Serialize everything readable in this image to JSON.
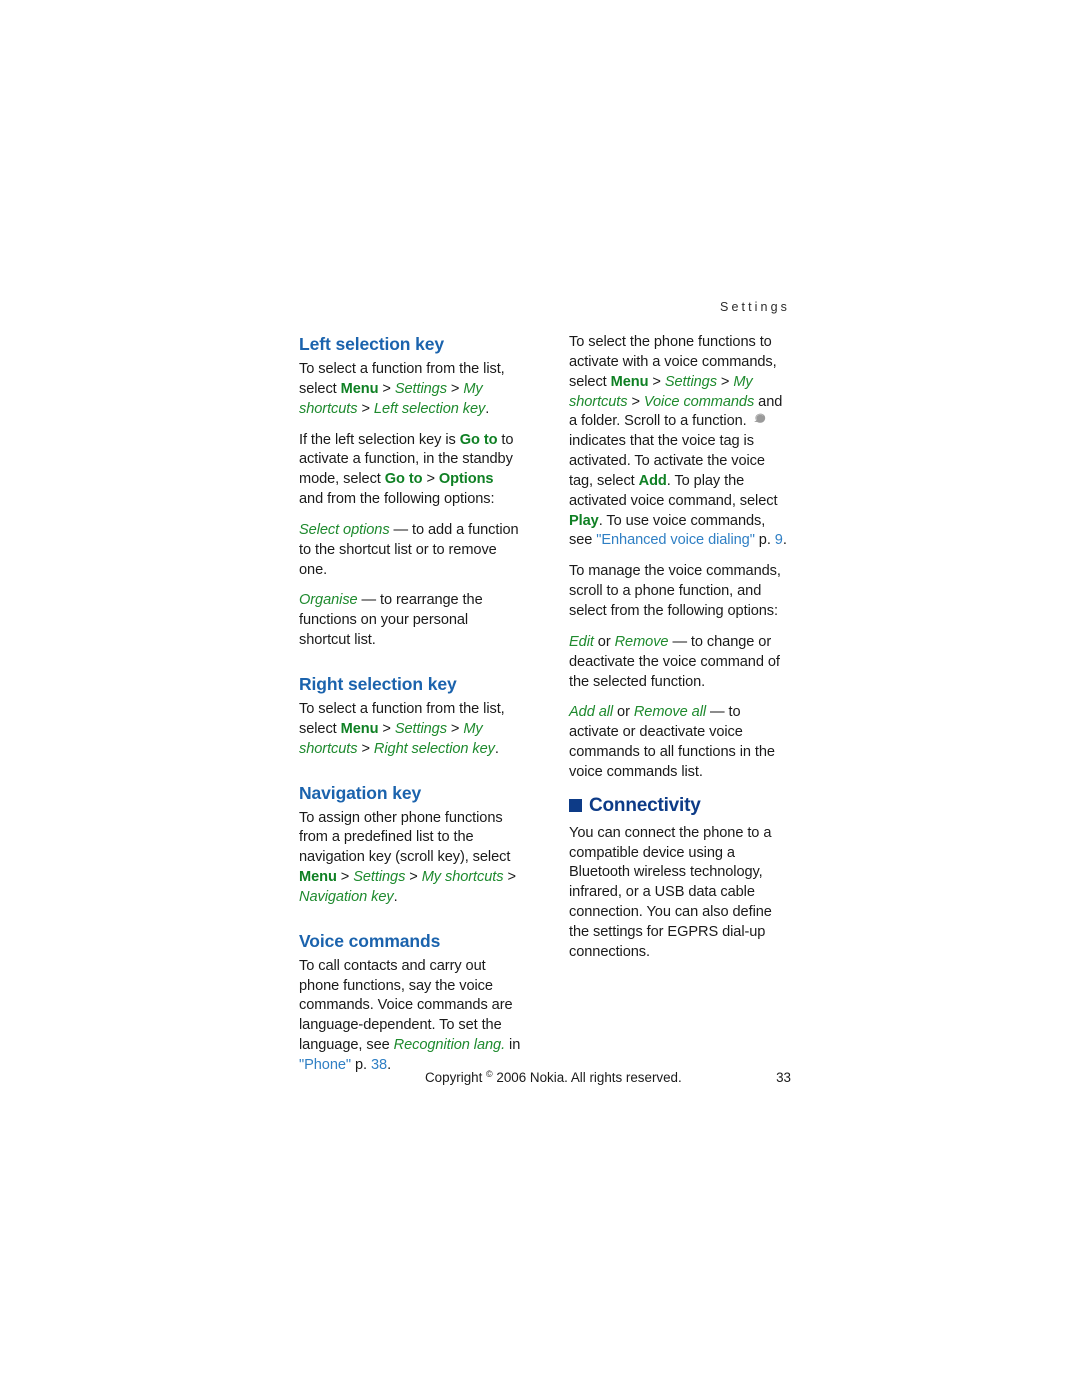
{
  "running_head": "Settings",
  "colors": {
    "section_heading": "#1b63ad",
    "chapter_heading": "#0d3b87",
    "menu_path_green": "#1e8a2e",
    "bold_term_green": "#0f8024",
    "cross_reference_link": "#2f7fc4",
    "body_text": "#1a1a1a",
    "page_background": "#ffffff"
  },
  "left_column": {
    "section_1": {
      "heading": "Left selection key",
      "p1": {
        "lead": "To select a function from the list, select ",
        "menu": "Menu",
        "sep1": " > ",
        "settings": "Settings",
        "sep2": " > ",
        "my_shortcuts": "My shortcuts",
        "sep3": " > ",
        "target": "Left selection key",
        "end": "."
      },
      "p2": {
        "lead": "If the left selection key is ",
        "term1": "Go to",
        "mid1": " to activate a function, in the standby mode, select ",
        "term2": "Go to",
        "sep": " > ",
        "term3": "Options",
        "end": " and from the following options:"
      },
      "p3": {
        "term": "Select options",
        "rest": " — to add a function to the shortcut list or to remove one."
      },
      "p4": {
        "term": "Organise",
        "rest": " — to rearrange the functions on your personal shortcut list."
      }
    },
    "section_2": {
      "heading": "Right selection key",
      "p1": {
        "lead": "To select a function from the list, select ",
        "menu": "Menu",
        "sep1": " > ",
        "settings": "Settings",
        "sep2": " > ",
        "my_shortcuts": "My shortcuts",
        "sep3": " > ",
        "target": "Right selection key",
        "end": "."
      }
    },
    "section_3": {
      "heading": "Navigation key",
      "p1": {
        "lead": "To assign other phone functions from a predefined list to the navigation key (scroll key), select ",
        "menu": "Menu",
        "sep1": " > ",
        "settings": "Settings",
        "sep2": " > ",
        "my_shortcuts": "My shortcuts",
        "sep3": " > ",
        "target": "Navigation key",
        "end": "."
      }
    },
    "section_4": {
      "heading": "Voice commands",
      "p1": {
        "lead": "To call contacts and carry out phone functions, say the voice commands. Voice commands are language-dependent. To set the language, see ",
        "term": "Recognition lang.",
        "mid": " in ",
        "link": "\"Phone\"",
        "page_prefix": " p. ",
        "page": "38",
        "end": "."
      }
    }
  },
  "right_column": {
    "p1": {
      "lead": "To select the phone functions to activate with a voice commands, select ",
      "menu": "Menu",
      "sep1": " > ",
      "settings": "Settings",
      "sep2": " > ",
      "my_shortcuts": "My shortcuts",
      "sep3": " > ",
      "voice_commands": "Voice commands",
      "after_path": " and a folder. Scroll to a function. ",
      "icon_name": "voice-tag-icon",
      "after_icon": " indicates that the voice tag is activated. To activate the voice tag, select ",
      "add": "Add",
      "mid1": ". To play the activated voice command, select ",
      "play": "Play",
      "mid2": ". To use voice commands, see ",
      "link": "\"Enhanced voice dialing\"",
      "page_prefix": " p. ",
      "page": "9",
      "end": "."
    },
    "p2": "To manage the voice commands, scroll to a phone function, and select from the following options:",
    "p3": {
      "term1": "Edit",
      "or": " or ",
      "term2": "Remove",
      "rest": " — to change or deactivate the voice command of the selected function."
    },
    "p4": {
      "term1": "Add all",
      "or": " or ",
      "term2": "Remove all",
      "rest": " — to activate or deactivate voice commands to all functions in the voice commands list."
    },
    "chapter": {
      "heading": "Connectivity",
      "p1": "You can connect the phone to a compatible device using a Bluetooth wireless technology, infrared, or a USB data cable connection. You can also define the settings for EGPRS dial-up connections."
    }
  },
  "footer": {
    "copyright_prefix": "Copyright ",
    "copyright_symbol": "©",
    "copyright_rest": " 2006 Nokia. All rights reserved.",
    "page_number": "33"
  }
}
